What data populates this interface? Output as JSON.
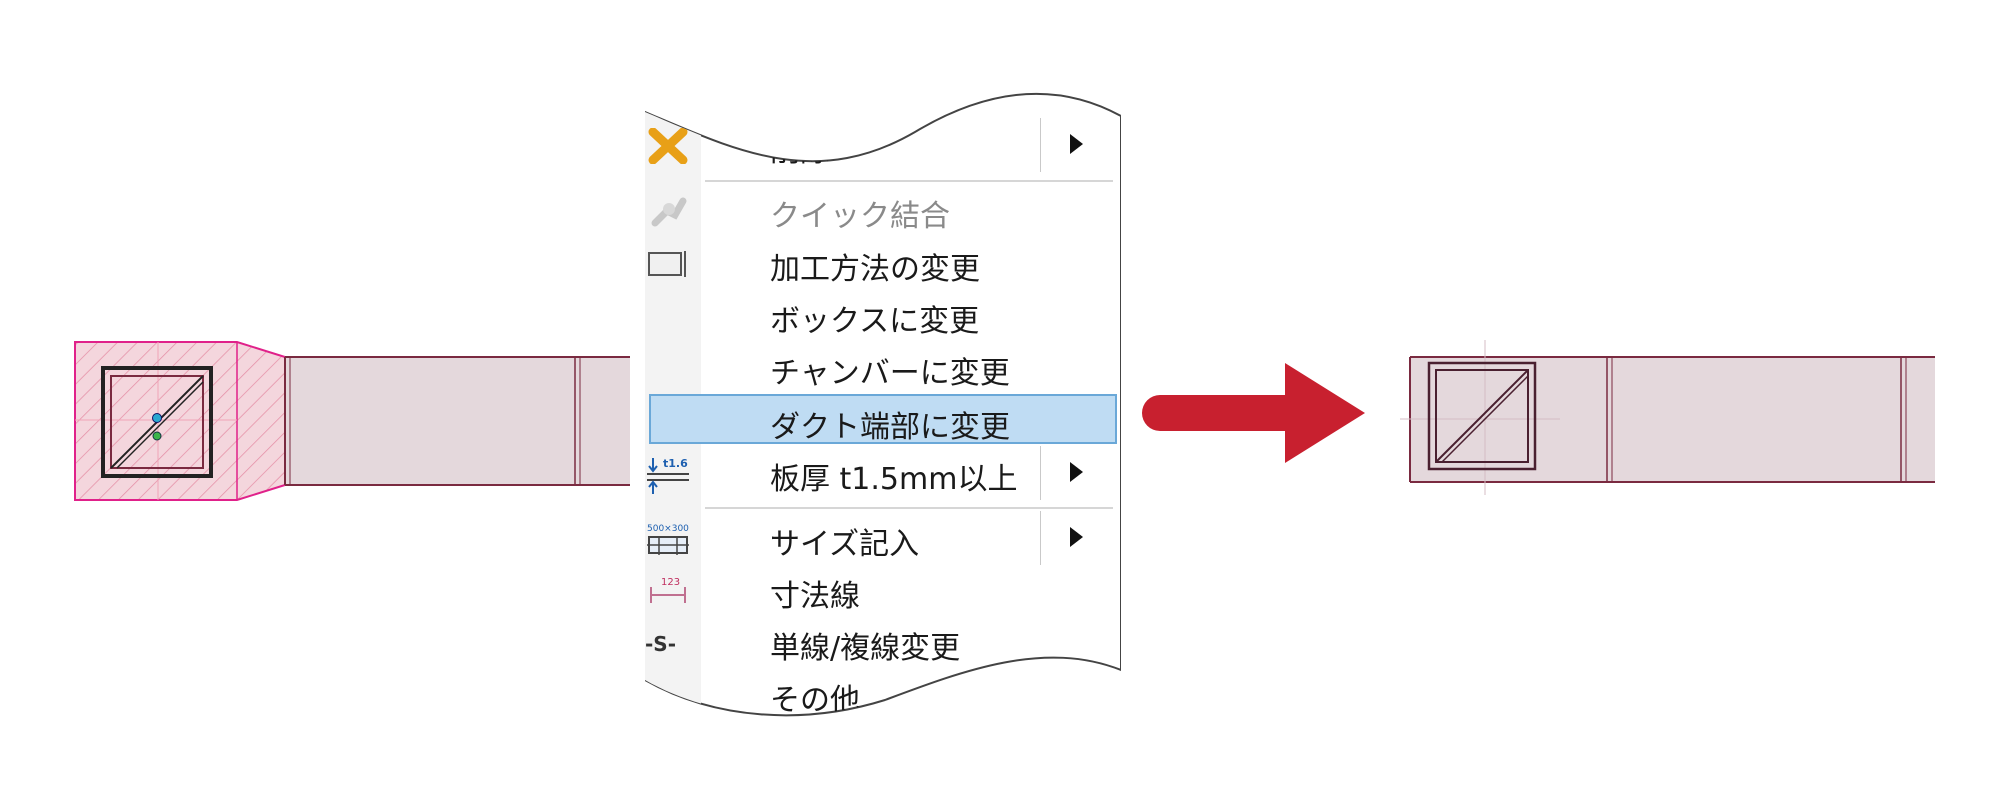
{
  "colors": {
    "duct_fill": "#e4d8dc",
    "duct_line": "#7a2a40",
    "selection": "#e0218a",
    "menu_highlight": "#bfdcf3",
    "arrow": "#c8202f"
  },
  "menu": {
    "items": [
      {
        "label": "削除",
        "icon": "delete-x-icon",
        "submenu": true,
        "partially_hidden": true
      },
      {
        "label": "クイック結合",
        "icon": "quick-join-icon",
        "disabled": true
      },
      {
        "label": "加工方法の変更",
        "icon": "processing-method-icon"
      },
      {
        "label": "ボックスに変更",
        "icon": ""
      },
      {
        "label": "チャンバーに変更",
        "icon": ""
      },
      {
        "label": "ダクト端部に変更",
        "icon": "",
        "highlighted": true
      },
      {
        "label": "板厚 t1.5mm以上",
        "icon": "plate-thickness-icon",
        "submenu": true
      },
      {
        "label": "サイズ記入",
        "icon": "size-annotation-icon",
        "submenu": true
      },
      {
        "label": "寸法線",
        "icon": "dimension-line-icon"
      },
      {
        "label": "単線/複線変更",
        "icon": "single-double-line-icon"
      },
      {
        "label": "その他",
        "icon": ""
      }
    ],
    "icon_texts": {
      "plate": "t1.6",
      "size": "500×300",
      "dimension": "123",
      "line_type": "-S-"
    }
  }
}
